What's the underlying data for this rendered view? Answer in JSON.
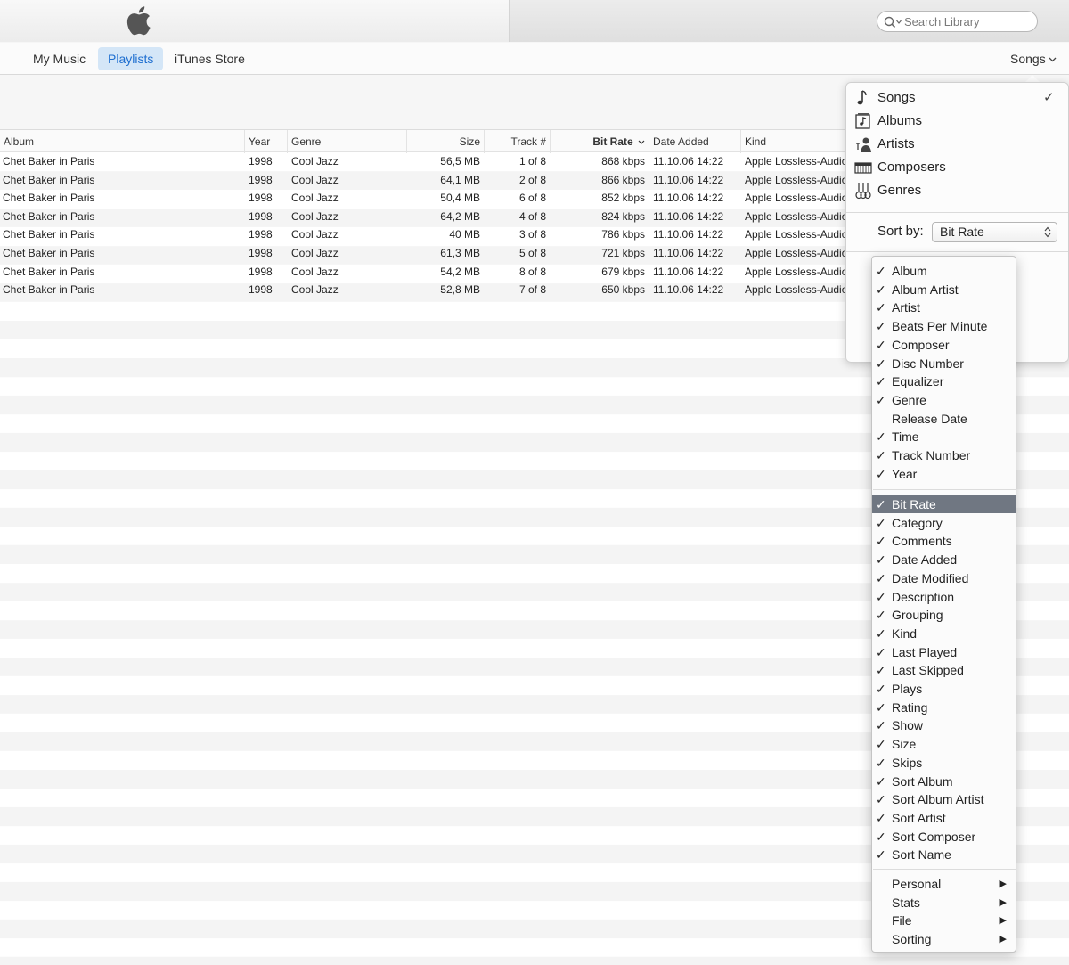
{
  "search": {
    "placeholder": "Search Library"
  },
  "nav": {
    "tabs": [
      {
        "label": "My Music",
        "active": false
      },
      {
        "label": "Playlists",
        "active": true
      },
      {
        "label": "iTunes Store",
        "active": false
      }
    ],
    "view_switch": "Songs"
  },
  "table": {
    "columns": [
      "Album",
      "Year",
      "Genre",
      "Size",
      "Track #",
      "Bit Rate",
      "Date Added",
      "Kind"
    ],
    "sorted_column": "Bit Rate",
    "rows": [
      {
        "album": "Chet Baker in Paris",
        "year": "1998",
        "genre": "Cool Jazz",
        "size": "56,5 MB",
        "track": "1 of 8",
        "bitrate": "868 kbps",
        "date_added": "11.10.06 14:22",
        "kind": "Apple Lossless-Audio"
      },
      {
        "album": "Chet Baker in Paris",
        "year": "1998",
        "genre": "Cool Jazz",
        "size": "64,1 MB",
        "track": "2 of 8",
        "bitrate": "866 kbps",
        "date_added": "11.10.06 14:22",
        "kind": "Apple Lossless-Audio"
      },
      {
        "album": "Chet Baker in Paris",
        "year": "1998",
        "genre": "Cool Jazz",
        "size": "50,4 MB",
        "track": "6 of 8",
        "bitrate": "852 kbps",
        "date_added": "11.10.06 14:22",
        "kind": "Apple Lossless-Audio"
      },
      {
        "album": "Chet Baker in Paris",
        "year": "1998",
        "genre": "Cool Jazz",
        "size": "64,2 MB",
        "track": "4 of 8",
        "bitrate": "824 kbps",
        "date_added": "11.10.06 14:22",
        "kind": "Apple Lossless-Audio"
      },
      {
        "album": "Chet Baker in Paris",
        "year": "1998",
        "genre": "Cool Jazz",
        "size": "40 MB",
        "track": "3 of 8",
        "bitrate": "786 kbps",
        "date_added": "11.10.06 14:22",
        "kind": "Apple Lossless-Audio"
      },
      {
        "album": "Chet Baker in Paris",
        "year": "1998",
        "genre": "Cool Jazz",
        "size": "61,3 MB",
        "track": "5 of 8",
        "bitrate": "721 kbps",
        "date_added": "11.10.06 14:22",
        "kind": "Apple Lossless-Audio"
      },
      {
        "album": "Chet Baker in Paris",
        "year": "1998",
        "genre": "Cool Jazz",
        "size": "54,2 MB",
        "track": "8 of 8",
        "bitrate": "679 kbps",
        "date_added": "11.10.06 14:22",
        "kind": "Apple Lossless-Audio"
      },
      {
        "album": "Chet Baker in Paris",
        "year": "1998",
        "genre": "Cool Jazz",
        "size": "52,8 MB",
        "track": "7 of 8",
        "bitrate": "650 kbps",
        "date_added": "11.10.06 14:22",
        "kind": "Apple Lossless-Audio"
      }
    ]
  },
  "view_popover": {
    "items": [
      {
        "label": "Songs",
        "icon": "note-icon",
        "checked": true
      },
      {
        "label": "Albums",
        "icon": "album-icon",
        "checked": false
      },
      {
        "label": "Artists",
        "icon": "artist-icon",
        "checked": false
      },
      {
        "label": "Composers",
        "icon": "piano-icon",
        "checked": false
      },
      {
        "label": "Genres",
        "icon": "guitars-icon",
        "checked": false
      }
    ],
    "checkmark": "✓",
    "sort_by_label": "Sort by:",
    "sort_by_value": "Bit Rate"
  },
  "column_menu": {
    "group1": [
      {
        "label": "Album",
        "checked": true
      },
      {
        "label": "Album Artist",
        "checked": true
      },
      {
        "label": "Artist",
        "checked": true
      },
      {
        "label": "Beats Per Minute",
        "checked": true
      },
      {
        "label": "Composer",
        "checked": true
      },
      {
        "label": "Disc Number",
        "checked": true
      },
      {
        "label": "Equalizer",
        "checked": true
      },
      {
        "label": "Genre",
        "checked": true
      },
      {
        "label": "Release Date",
        "checked": false
      },
      {
        "label": "Time",
        "checked": true
      },
      {
        "label": "Track Number",
        "checked": true
      },
      {
        "label": "Year",
        "checked": true
      }
    ],
    "group2": [
      {
        "label": "Bit Rate",
        "checked": true,
        "highlighted": true
      },
      {
        "label": "Category",
        "checked": true
      },
      {
        "label": "Comments",
        "checked": true
      },
      {
        "label": "Date Added",
        "checked": true
      },
      {
        "label": "Date Modified",
        "checked": true
      },
      {
        "label": "Description",
        "checked": true
      },
      {
        "label": "Grouping",
        "checked": true
      },
      {
        "label": "Kind",
        "checked": true
      },
      {
        "label": "Last Played",
        "checked": true
      },
      {
        "label": "Last Skipped",
        "checked": true
      },
      {
        "label": "Plays",
        "checked": true
      },
      {
        "label": "Rating",
        "checked": true
      },
      {
        "label": "Show",
        "checked": true
      },
      {
        "label": "Size",
        "checked": true
      },
      {
        "label": "Skips",
        "checked": true
      },
      {
        "label": "Sort Album",
        "checked": true
      },
      {
        "label": "Sort Album Artist",
        "checked": true
      },
      {
        "label": "Sort Artist",
        "checked": true
      },
      {
        "label": "Sort Composer",
        "checked": true
      },
      {
        "label": "Sort Name",
        "checked": true
      }
    ],
    "submenus": [
      {
        "label": "Personal"
      },
      {
        "label": "Stats"
      },
      {
        "label": "File"
      },
      {
        "label": "Sorting"
      }
    ],
    "checkmark": "✓",
    "submenu_arrow": "▶"
  },
  "colors": {
    "accent": "#1f6fd0",
    "tab_active_bg": "#d4e6f7",
    "menu_highlight": "#707782"
  }
}
